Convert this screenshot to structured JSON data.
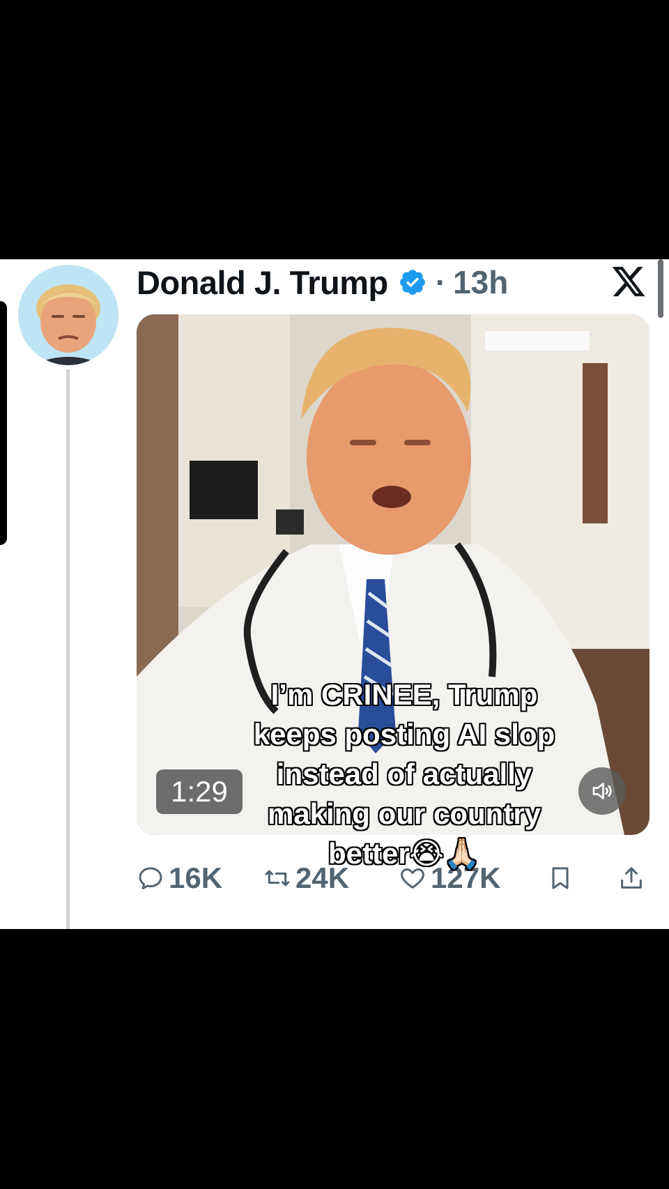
{
  "post": {
    "display_name": "Donald J. Trump",
    "separator": "·",
    "timestamp": "13h",
    "verified_icon": "verified-badge-icon",
    "platform_icon": "x-logo-icon"
  },
  "media": {
    "duration": "1:29",
    "mute_icon": "speaker-icon"
  },
  "caption": {
    "lines": [
      "I’m CRINEE, Trump",
      "keeps posting AI slop",
      "instead of actually",
      "making our country",
      "better😭🙏🏻"
    ]
  },
  "actions": {
    "replies": "16K",
    "reposts": "24K",
    "likes": "127K"
  },
  "colors": {
    "text_primary": "#0f1419",
    "text_secondary": "#536471",
    "verified": "#1d9bf0",
    "thread_line": "#cfd3d6"
  }
}
